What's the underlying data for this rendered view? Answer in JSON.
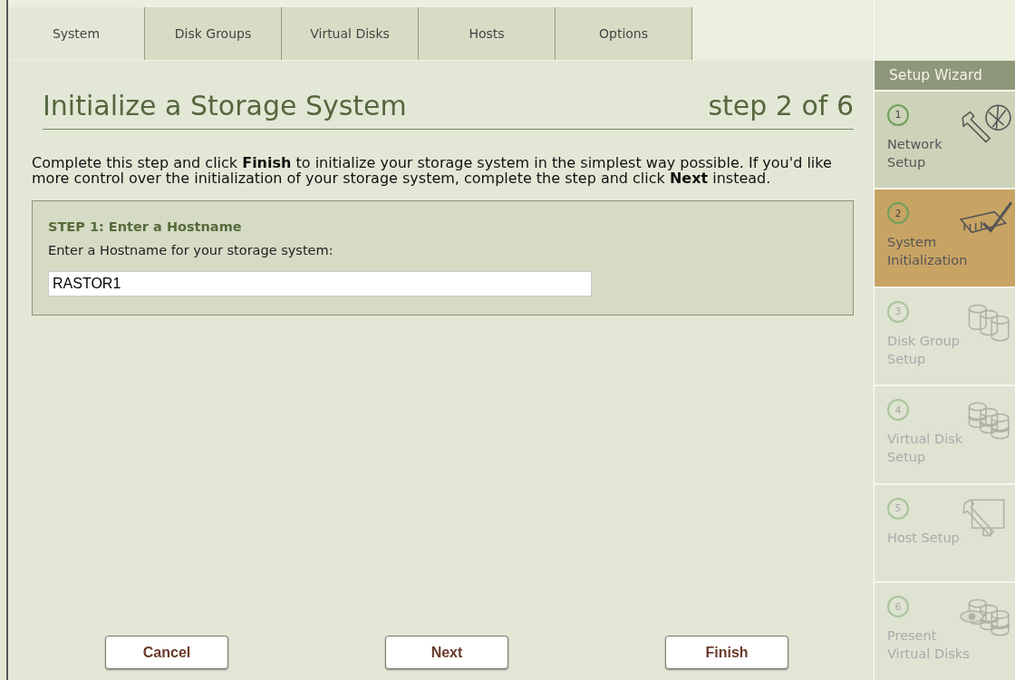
{
  "tabs": [
    {
      "label": "System",
      "selected": true
    },
    {
      "label": "Disk Groups",
      "selected": false
    },
    {
      "label": "Virtual Disks",
      "selected": false
    },
    {
      "label": "Hosts",
      "selected": false
    },
    {
      "label": "Options",
      "selected": false
    }
  ],
  "title": "Initialize a Storage System",
  "step_indicator": "step 2 of 6",
  "intro": "Complete this step and click **Finish** to initialize your storage system in the simplest way possible. If you'd like more control over the initialization of your storage system, complete the step and click **Next** instead.",
  "step_box": {
    "heading": "STEP 1: Enter a Hostname",
    "label": "Enter a Hostname for your storage system:",
    "value": "RASTOR1"
  },
  "buttons": [
    "Cancel",
    "Next",
    "Finish"
  ],
  "wizard": {
    "title": "Setup Wizard",
    "steps": [
      {
        "number": "1",
        "label": "Network Setup",
        "selected": false,
        "disabled": false
      },
      {
        "number": "2",
        "label": "System Initialization",
        "selected": true,
        "disabled": false
      },
      {
        "number": "3",
        "label": "Disk Group Setup",
        "selected": false,
        "disabled": true
      },
      {
        "number": "4",
        "label": "Virtual Disk Setup",
        "selected": false,
        "disabled": true
      },
      {
        "number": "5",
        "label": "Host Setup",
        "selected": false,
        "disabled": true
      },
      {
        "number": "6",
        "label": "Present Virtual Disks",
        "selected": false,
        "disabled": true
      }
    ]
  }
}
